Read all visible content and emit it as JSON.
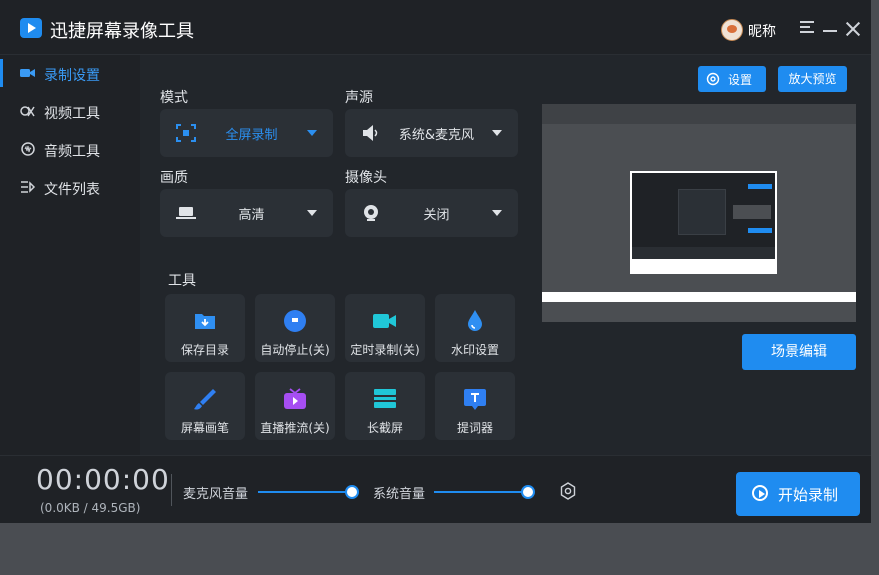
{
  "app": {
    "title": "迅捷屏幕录像工具",
    "nickname": "昵称"
  },
  "sidebar": {
    "items": [
      {
        "label": "录制设置",
        "icon": "video-camera-icon",
        "active": true
      },
      {
        "label": "视频工具",
        "icon": "video-tools-icon",
        "active": false
      },
      {
        "label": "音频工具",
        "icon": "audio-tools-icon",
        "active": false
      },
      {
        "label": "文件列表",
        "icon": "file-list-icon",
        "active": false
      }
    ]
  },
  "settings": {
    "mode": {
      "label": "模式",
      "value": "全屏录制"
    },
    "audio_source": {
      "label": "声源",
      "value": "系统&麦克风"
    },
    "quality": {
      "label": "画质",
      "value": "高清"
    },
    "camera": {
      "label": "摄像头",
      "value": "关闭"
    }
  },
  "tools": {
    "label": "工具",
    "items": [
      {
        "label": "保存目录",
        "icon": "folder-icon"
      },
      {
        "label": "自动停止(关)",
        "icon": "auto-stop-icon"
      },
      {
        "label": "定时录制(关)",
        "icon": "timer-camera-icon"
      },
      {
        "label": "水印设置",
        "icon": "watermark-icon"
      },
      {
        "label": "屏幕画笔",
        "icon": "brush-icon"
      },
      {
        "label": "直播推流(关)",
        "icon": "live-tv-icon"
      },
      {
        "label": "长截屏",
        "icon": "long-screenshot-icon"
      },
      {
        "label": "提词器",
        "icon": "teleprompter-icon"
      }
    ]
  },
  "preview": {
    "settings_label": "设置",
    "zoom_label": "放大预览",
    "scene_label": "场景编辑"
  },
  "bottom": {
    "timer": "00:00:00",
    "storage": "(0.0KB / 49.5GB)",
    "mic_label": "麦克风音量",
    "sys_label": "系统音量",
    "mic_level": 1.0,
    "sys_level": 1.0,
    "record_label": "开始录制"
  },
  "colors": {
    "accent": "#1f8cf0",
    "background": "#1f2226",
    "panel": "#2b3036"
  }
}
